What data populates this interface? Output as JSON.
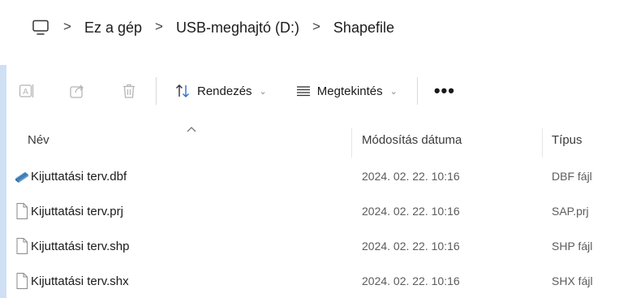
{
  "breadcrumb": {
    "icon": "computer-icon",
    "items": [
      "Ez a gép",
      "USB-meghajtó (D:)",
      "Shapefile"
    ],
    "separator": ">"
  },
  "toolbar": {
    "actions": [
      {
        "name": "rename",
        "icon": "rename-icon"
      },
      {
        "name": "share",
        "icon": "share-icon"
      },
      {
        "name": "delete",
        "icon": "trash-icon"
      }
    ],
    "sort_label": "Rendezés",
    "view_label": "Megtekintés",
    "more_label": "•••",
    "caret": "⌄"
  },
  "columns": {
    "name": "Név",
    "modified": "Módosítás dátuma",
    "type": "Típus"
  },
  "files": [
    {
      "name": "Kijuttatási terv.dbf",
      "modified": "2024. 02. 22. 10:16",
      "type": "DBF fájl",
      "icon": "database-file-icon"
    },
    {
      "name": "Kijuttatási terv.prj",
      "modified": "2024. 02. 22. 10:16",
      "type": "SAP.prj",
      "icon": "blank-file-icon"
    },
    {
      "name": "Kijuttatási terv.shp",
      "modified": "2024. 02. 22. 10:16",
      "type": "SHP fájl",
      "icon": "blank-file-icon"
    },
    {
      "name": "Kijuttatási terv.shx",
      "modified": "2024. 02. 22. 10:16",
      "type": "SHX fájl",
      "icon": "blank-file-icon"
    }
  ],
  "colors": {
    "accent_strip": "#cfe0f5",
    "sort_arrow_blue": "#2b6fd6",
    "disabled_icon": "#b5b5b5"
  }
}
